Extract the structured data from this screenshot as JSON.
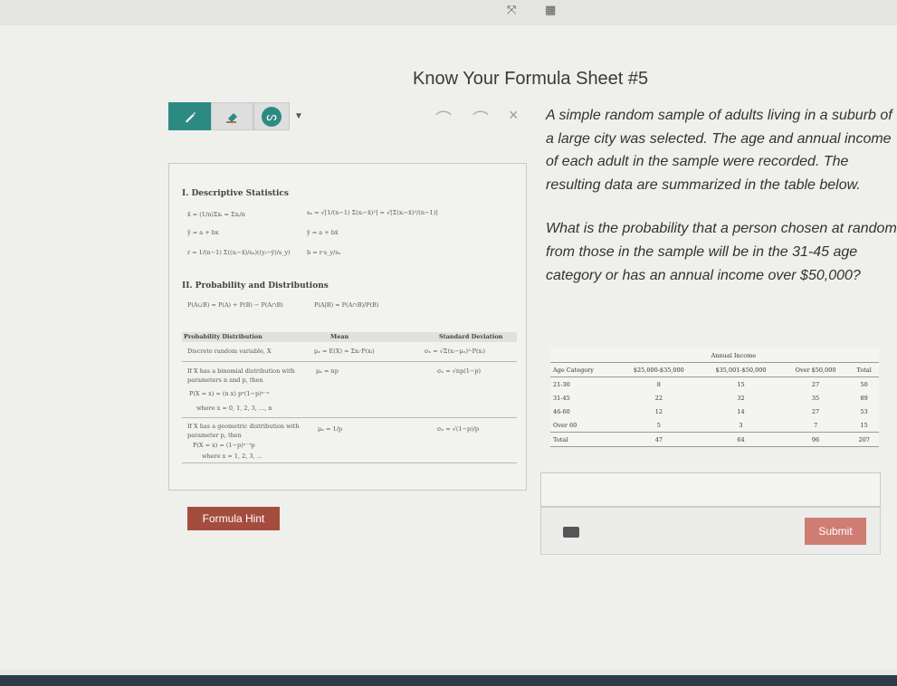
{
  "toolbar": {
    "tools": [
      "pencil-icon",
      "eraser-icon",
      "pen-icon",
      "chevron-down-icon"
    ],
    "undo_glyph": "⌒",
    "redo_glyph": "⌒",
    "close_glyph": "×",
    "top_icons": [
      "expand-icon",
      "calculator-icon"
    ],
    "expand_glyph": "⤧",
    "calculator_glyph": "▦"
  },
  "page_title": "Know Your Formula Sheet #5",
  "formula_sheet": {
    "section1": "I. Descriptive Statistics",
    "f_mean": "x̄ = (1/n)Σxᵢ = Σxᵢ/n",
    "f_sd": "sₓ = √[1/(n−1) Σ(xᵢ−x̄)²] = √[Σ(xᵢ−x̄)²/(n−1)]",
    "f_yhat1": "ŷ = a + bx",
    "f_yhat2": "ȳ = a + bx̄",
    "f_r": "r = 1/(n−1) Σ((xᵢ−x̄)/sₓ)((yᵢ−ȳ)/s_y)",
    "f_b": "b = r·s_y/sₓ",
    "section2": "II. Probability and Distributions",
    "f_union": "P(A∪B) = P(A) + P(B) − P(A∩B)",
    "f_cond": "P(A|B) = P(A∩B)/P(B)",
    "table_headers": [
      "Probability Distribution",
      "Mean",
      "Standard Deviation"
    ],
    "row1_desc": "Discrete random variable, X",
    "row1_mean": "μₓ = E(X) = Σxᵢ·P(xᵢ)",
    "row1_sd": "σₓ = √Σ(xᵢ−μₓ)²·P(xᵢ)",
    "row2_desc1": "If X has a binomial distribution with",
    "row2_desc2": "parameters n and p, then",
    "row2_formula": "P(X = x) = (n x) pˣ(1−p)ⁿ⁻ˣ",
    "row2_where": "where x = 0, 1, 2, 3, ..., n",
    "row2_mean": "μₓ = np",
    "row2_sd": "σₓ = √np(1−p)",
    "row3_desc1": "If X has a geometric distribution with",
    "row3_desc2": "parameter p, then",
    "row3_formula": "P(X = x) = (1−p)ˣ⁻¹p",
    "row3_where": "where x = 1, 2, 3, ...",
    "row3_mean": "μₓ = 1/p",
    "row3_sd": "σₓ = √(1−p)/p"
  },
  "formula_hint_label": "Formula Hint",
  "question": {
    "paragraph1": "A simple random sample of adults living in a suburb of a large city was selected. The age and annual income of each adult in the sample were recorded. The resulting data are summarized in the table below.",
    "paragraph2": "What is the probability that a person chosen at random from those in the sample will be in the 31-45 age category or has an annual income over $50,000?"
  },
  "income_table": {
    "group_header": "Annual Income",
    "columns": [
      "Age Category",
      "$25,000-$35,000",
      "$35,001-$50,000",
      "Over $50,000",
      "Total"
    ],
    "rows": [
      [
        "21-30",
        "8",
        "15",
        "27",
        "50"
      ],
      [
        "31-45",
        "22",
        "32",
        "35",
        "89"
      ],
      [
        "46-60",
        "12",
        "14",
        "27",
        "53"
      ],
      [
        "Over 60",
        "5",
        "3",
        "7",
        "15"
      ]
    ],
    "total_row": [
      "Total",
      "47",
      "64",
      "96",
      "207"
    ]
  },
  "submit_label": "Submit",
  "colors": {
    "accent_teal": "#2d8a82",
    "hint_button": "#a44c3e",
    "submit_button": "#cf7d72"
  }
}
